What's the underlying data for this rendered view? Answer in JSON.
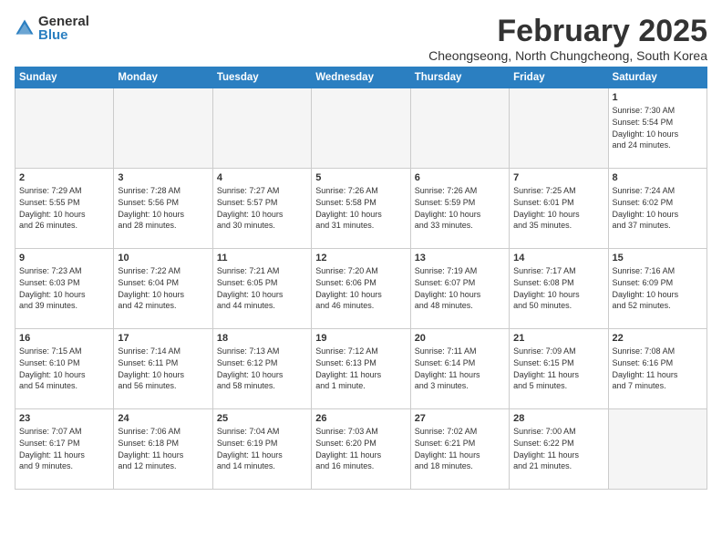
{
  "header": {
    "logo_general": "General",
    "logo_blue": "Blue",
    "title": "February 2025",
    "subtitle": "Cheongseong, North Chungcheong, South Korea"
  },
  "weekdays": [
    "Sunday",
    "Monday",
    "Tuesday",
    "Wednesday",
    "Thursday",
    "Friday",
    "Saturday"
  ],
  "weeks": [
    [
      {
        "day": "",
        "info": ""
      },
      {
        "day": "",
        "info": ""
      },
      {
        "day": "",
        "info": ""
      },
      {
        "day": "",
        "info": ""
      },
      {
        "day": "",
        "info": ""
      },
      {
        "day": "",
        "info": ""
      },
      {
        "day": "1",
        "info": "Sunrise: 7:30 AM\nSunset: 5:54 PM\nDaylight: 10 hours\nand 24 minutes."
      }
    ],
    [
      {
        "day": "2",
        "info": "Sunrise: 7:29 AM\nSunset: 5:55 PM\nDaylight: 10 hours\nand 26 minutes."
      },
      {
        "day": "3",
        "info": "Sunrise: 7:28 AM\nSunset: 5:56 PM\nDaylight: 10 hours\nand 28 minutes."
      },
      {
        "day": "4",
        "info": "Sunrise: 7:27 AM\nSunset: 5:57 PM\nDaylight: 10 hours\nand 30 minutes."
      },
      {
        "day": "5",
        "info": "Sunrise: 7:26 AM\nSunset: 5:58 PM\nDaylight: 10 hours\nand 31 minutes."
      },
      {
        "day": "6",
        "info": "Sunrise: 7:26 AM\nSunset: 5:59 PM\nDaylight: 10 hours\nand 33 minutes."
      },
      {
        "day": "7",
        "info": "Sunrise: 7:25 AM\nSunset: 6:01 PM\nDaylight: 10 hours\nand 35 minutes."
      },
      {
        "day": "8",
        "info": "Sunrise: 7:24 AM\nSunset: 6:02 PM\nDaylight: 10 hours\nand 37 minutes."
      }
    ],
    [
      {
        "day": "9",
        "info": "Sunrise: 7:23 AM\nSunset: 6:03 PM\nDaylight: 10 hours\nand 39 minutes."
      },
      {
        "day": "10",
        "info": "Sunrise: 7:22 AM\nSunset: 6:04 PM\nDaylight: 10 hours\nand 42 minutes."
      },
      {
        "day": "11",
        "info": "Sunrise: 7:21 AM\nSunset: 6:05 PM\nDaylight: 10 hours\nand 44 minutes."
      },
      {
        "day": "12",
        "info": "Sunrise: 7:20 AM\nSunset: 6:06 PM\nDaylight: 10 hours\nand 46 minutes."
      },
      {
        "day": "13",
        "info": "Sunrise: 7:19 AM\nSunset: 6:07 PM\nDaylight: 10 hours\nand 48 minutes."
      },
      {
        "day": "14",
        "info": "Sunrise: 7:17 AM\nSunset: 6:08 PM\nDaylight: 10 hours\nand 50 minutes."
      },
      {
        "day": "15",
        "info": "Sunrise: 7:16 AM\nSunset: 6:09 PM\nDaylight: 10 hours\nand 52 minutes."
      }
    ],
    [
      {
        "day": "16",
        "info": "Sunrise: 7:15 AM\nSunset: 6:10 PM\nDaylight: 10 hours\nand 54 minutes."
      },
      {
        "day": "17",
        "info": "Sunrise: 7:14 AM\nSunset: 6:11 PM\nDaylight: 10 hours\nand 56 minutes."
      },
      {
        "day": "18",
        "info": "Sunrise: 7:13 AM\nSunset: 6:12 PM\nDaylight: 10 hours\nand 58 minutes."
      },
      {
        "day": "19",
        "info": "Sunrise: 7:12 AM\nSunset: 6:13 PM\nDaylight: 11 hours\nand 1 minute."
      },
      {
        "day": "20",
        "info": "Sunrise: 7:11 AM\nSunset: 6:14 PM\nDaylight: 11 hours\nand 3 minutes."
      },
      {
        "day": "21",
        "info": "Sunrise: 7:09 AM\nSunset: 6:15 PM\nDaylight: 11 hours\nand 5 minutes."
      },
      {
        "day": "22",
        "info": "Sunrise: 7:08 AM\nSunset: 6:16 PM\nDaylight: 11 hours\nand 7 minutes."
      }
    ],
    [
      {
        "day": "23",
        "info": "Sunrise: 7:07 AM\nSunset: 6:17 PM\nDaylight: 11 hours\nand 9 minutes."
      },
      {
        "day": "24",
        "info": "Sunrise: 7:06 AM\nSunset: 6:18 PM\nDaylight: 11 hours\nand 12 minutes."
      },
      {
        "day": "25",
        "info": "Sunrise: 7:04 AM\nSunset: 6:19 PM\nDaylight: 11 hours\nand 14 minutes."
      },
      {
        "day": "26",
        "info": "Sunrise: 7:03 AM\nSunset: 6:20 PM\nDaylight: 11 hours\nand 16 minutes."
      },
      {
        "day": "27",
        "info": "Sunrise: 7:02 AM\nSunset: 6:21 PM\nDaylight: 11 hours\nand 18 minutes."
      },
      {
        "day": "28",
        "info": "Sunrise: 7:00 AM\nSunset: 6:22 PM\nDaylight: 11 hours\nand 21 minutes."
      },
      {
        "day": "",
        "info": ""
      }
    ]
  ]
}
